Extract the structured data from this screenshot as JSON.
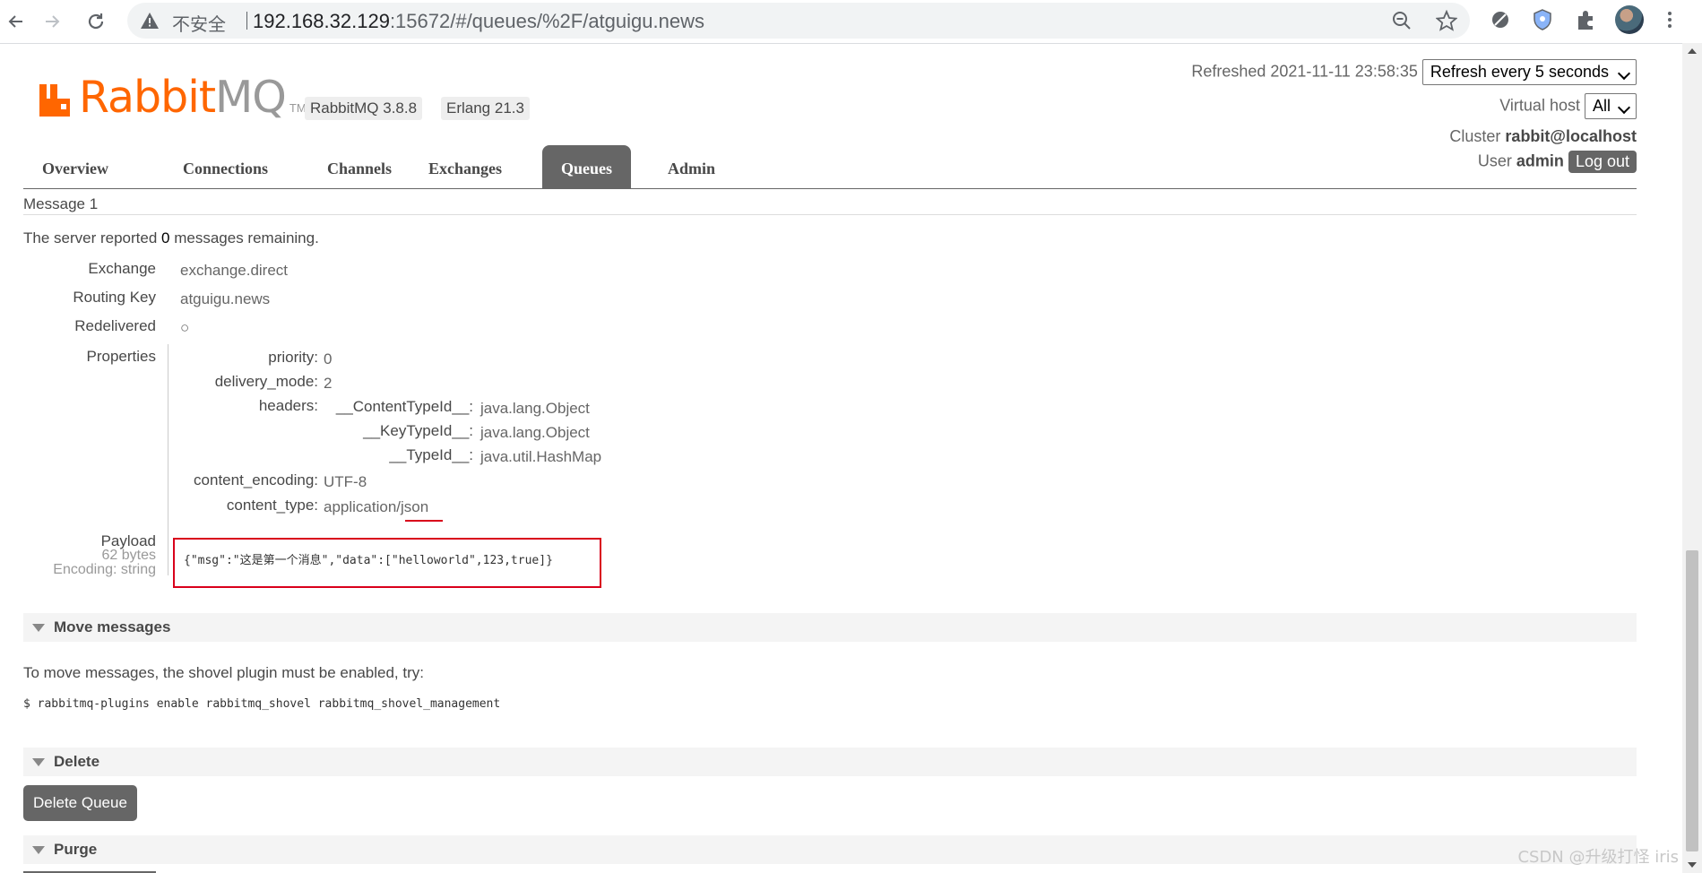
{
  "browser": {
    "insecure_label": "不安全",
    "url_host": "192.168.32.129",
    "url_rest": ":15672/#/queues/%2F/atguigu.news"
  },
  "brand": {
    "logo_text_a": "Rabbit",
    "logo_text_b": "MQ",
    "logo_tm": "TM",
    "rabbitmq_version": "RabbitMQ 3.8.8",
    "erlang_version": "Erlang 21.3"
  },
  "header": {
    "refreshed_label": "Refreshed 2021-11-11 23:58:35",
    "refresh_select": "Refresh every 5 seconds",
    "vhost_label": "Virtual host",
    "vhost_select": "All",
    "cluster_label": "Cluster",
    "cluster_value": "rabbit@localhost",
    "user_label": "User",
    "user_value": "admin",
    "logout_label": "Log out"
  },
  "tabs": [
    {
      "label": "Overview"
    },
    {
      "label": "Connections"
    },
    {
      "label": "Channels"
    },
    {
      "label": "Exchanges"
    },
    {
      "label": "Queues"
    },
    {
      "label": "Admin"
    }
  ],
  "message": {
    "title": "Message 1",
    "remaining_prefix": "The server reported",
    "remaining_count": "0",
    "remaining_suffix": "messages remaining.",
    "exchange_label": "Exchange",
    "exchange_value": "exchange.direct",
    "routing_key_label": "Routing Key",
    "routing_key_value": "atguigu.news",
    "redelivered_label": "Redelivered",
    "redelivered_value": "○",
    "properties_label": "Properties",
    "properties": {
      "priority_label": "priority:",
      "priority_value": "0",
      "delivery_mode_label": "delivery_mode:",
      "delivery_mode_value": "2",
      "headers_label": "headers:",
      "header_content_type_id_label": "__ContentTypeId__:",
      "header_content_type_id_value": "java.lang.Object",
      "header_key_type_id_label": "__KeyTypeId__:",
      "header_key_type_id_value": "java.lang.Object",
      "header_type_id_label": "__TypeId__:",
      "header_type_id_value": "java.util.HashMap",
      "content_encoding_label": "content_encoding:",
      "content_encoding_value": "UTF-8",
      "content_type_label": "content_type:",
      "content_type_value": "application/json"
    },
    "payload_label": "Payload",
    "payload_size": "62 bytes",
    "payload_encoding": "Encoding: string",
    "payload_text": "{\"msg\":\"这是第一个消息\",\"data\":[\"helloworld\",123,true]}"
  },
  "move": {
    "title": "Move messages",
    "hint": "To move messages, the shovel plugin must be enabled, try:",
    "command": "$ rabbitmq-plugins enable rabbitmq_shovel rabbitmq_shovel_management"
  },
  "delete": {
    "title": "Delete",
    "button_label": "Delete Queue"
  },
  "purge": {
    "title": "Purge"
  },
  "watermark": "CSDN @升级打怪 iris",
  "colors": {
    "brand_orange": "#ff6600",
    "active_tab": "#666666",
    "highlight_red": "#d9001b"
  }
}
